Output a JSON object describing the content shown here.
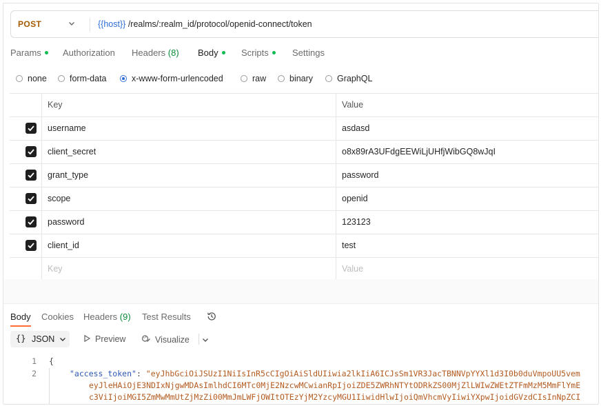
{
  "request": {
    "method": "POST",
    "url_variable": "{{host}}",
    "url_path": "/realms/:realm_id/protocol/openid-connect/token"
  },
  "request_tabs": [
    {
      "label": "Params",
      "dot": true
    },
    {
      "label": "Authorization"
    },
    {
      "label": "Headers",
      "count": "(8)"
    },
    {
      "label": "Body",
      "dot": true,
      "active": true
    },
    {
      "label": "Scripts",
      "dot": true
    },
    {
      "label": "Settings"
    }
  ],
  "body_types": {
    "none": "none",
    "form_data": "form-data",
    "urlencoded": "x-www-form-urlencoded",
    "raw": "raw",
    "binary": "binary",
    "graphql": "GraphQL",
    "selected": "x-www-form-urlencoded"
  },
  "table": {
    "header": {
      "key": "Key",
      "value": "Value"
    },
    "rows": [
      {
        "key": "username",
        "value": "asdasd",
        "checked": true
      },
      {
        "key": "client_secret",
        "value": "o8x89rA3UFdgEEWiLjUHfjWibGQ8wJqI",
        "checked": true
      },
      {
        "key": "grant_type",
        "value": "password",
        "checked": true
      },
      {
        "key": "scope",
        "value": "openid",
        "checked": true
      },
      {
        "key": "password",
        "value": "123123",
        "checked": true
      },
      {
        "key": "client_id",
        "value": "test",
        "checked": true
      }
    ],
    "placeholder": {
      "key": "Key",
      "value": "Value"
    }
  },
  "response_tabs": {
    "body": "Body",
    "cookies": "Cookies",
    "headers_label": "Headers",
    "headers_count": "(9)",
    "test_results": "Test Results"
  },
  "response_toolbar": {
    "format_braces": "{}",
    "format": "JSON",
    "preview": "Preview",
    "visualize": "Visualize"
  },
  "code": {
    "line1_num": "1",
    "line2_num": "2",
    "line1": "{",
    "key": "\"access_token\"",
    "colon": ": ",
    "line2_value": "\"eyJhbGciOiJSUzI1NiIsInR5cCIgOiAiSldUIiwia2lkIiA6ICJsSm1VR3JacTBNNVpYYXl1d3I0b0duVmpoUU5vem",
    "line3": "eyJleHAiOjE3NDIxNjgwMDAsImlhdCI6MTc0MjE2NzcwMCwianRpIjoiZDE5ZWRhNTYtODRkZS00MjZlLWIwZWEtZTFmMzM5MmFlYmE",
    "line4": "c3ViIjoiMGI5ZmMwMmUtZjMzZi00MmJmLWFjOWItOTEzYjM2YzcyMGU1IiwidHlwIjoiQmVhcmVyIiwiYXpwIjoidGVzdCIsInNpZCI"
  },
  "colors": {
    "accent_orange": "#ff6c37",
    "method_orange": "#a45a00",
    "variable_blue": "#2f6fd6",
    "dot_green": "#0cbb52",
    "json_key_blue": "#2f58b8",
    "json_string_orange": "#b35a1f"
  },
  "icons": [
    "chevron-down-icon",
    "checkbox-check-icon",
    "history-icon",
    "play-icon",
    "visualize-icon"
  ]
}
